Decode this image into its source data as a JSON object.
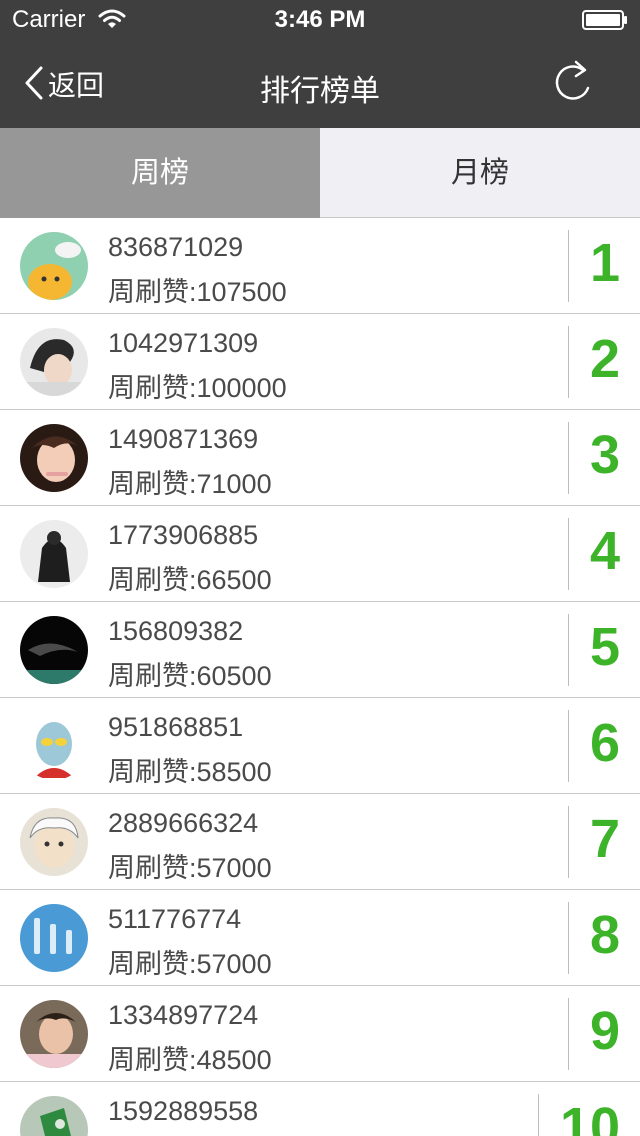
{
  "status_bar": {
    "carrier": "Carrier",
    "time": "3:46 PM"
  },
  "nav": {
    "back_label": "返回",
    "title": "排行榜单"
  },
  "tabs": [
    {
      "label": "周榜",
      "selected": true
    },
    {
      "label": "月榜",
      "selected": false
    }
  ],
  "colors": {
    "bar_bg": "#3f3f3f",
    "selected_tab": "#979797",
    "rank_green": "#3db32a"
  },
  "ranking": [
    {
      "rank": "1",
      "user_id": "836871029",
      "likes": "周刷赞:107500"
    },
    {
      "rank": "2",
      "user_id": "1042971309",
      "likes": "周刷赞:100000"
    },
    {
      "rank": "3",
      "user_id": "1490871369",
      "likes": "周刷赞:71000"
    },
    {
      "rank": "4",
      "user_id": "1773906885",
      "likes": "周刷赞:66500"
    },
    {
      "rank": "5",
      "user_id": "156809382",
      "likes": "周刷赞:60500"
    },
    {
      "rank": "6",
      "user_id": "951868851",
      "likes": "周刷赞:58500"
    },
    {
      "rank": "7",
      "user_id": "2889666324",
      "likes": "周刷赞:57000"
    },
    {
      "rank": "8",
      "user_id": "511776774",
      "likes": "周刷赞:57000"
    },
    {
      "rank": "9",
      "user_id": "1334897724",
      "likes": "周刷赞:48500"
    },
    {
      "rank": "10",
      "user_id": "1592889558",
      "likes": ""
    }
  ]
}
